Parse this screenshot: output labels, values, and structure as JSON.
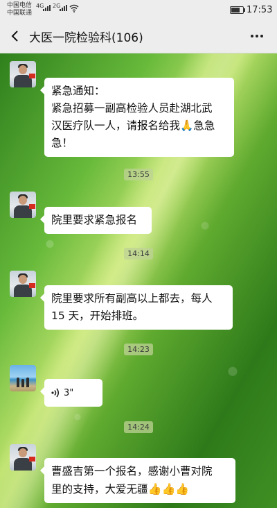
{
  "status": {
    "carrier1": "中国电信",
    "carrier2": "中国联通",
    "net1": "4G",
    "net2": "2G",
    "time": "17:53"
  },
  "header": {
    "title": "大医一院检验科(106)",
    "back_icon": "back-arrow-icon",
    "more_icon": "more-dots-icon"
  },
  "messages": [
    {
      "text_line1": "紧急通知：",
      "text_line2": "紧急招募一副高检验人员赴湖北武",
      "text_line3": "汉医疗队一人，请报名给我",
      "emoji": "🙏",
      "text_line3b": "急急",
      "text_line4": "急！"
    },
    {
      "timestamp": "13:55",
      "text": "院里要求紧急报名"
    },
    {
      "timestamp": "14:14",
      "text_line1": "院里要求所有副高以上都去，每人",
      "text_line2": "15 天，开始排班。"
    },
    {
      "timestamp": "14:23",
      "duration": "3\""
    },
    {
      "timestamp": "14:24",
      "text_line1": "曹盛吉第一个报名，感谢小曹对院",
      "text_line2": "里的支持，大爱无疆",
      "emoji": "👍👍👍"
    }
  ]
}
